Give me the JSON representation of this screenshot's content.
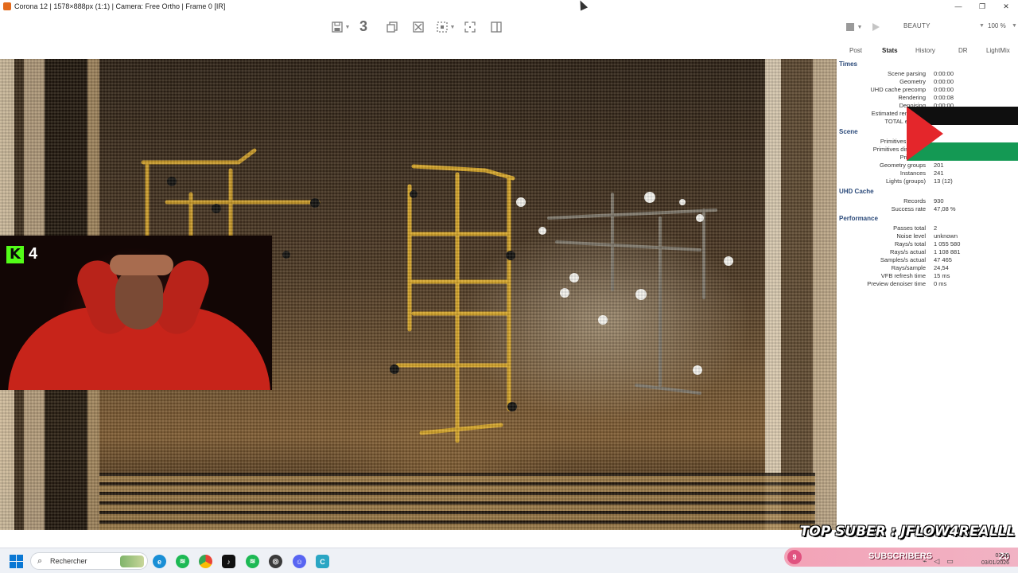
{
  "window": {
    "title": "Corona 12 | 1578×888px (1:1) | Camera: Free Ortho | Frame 0 [IR]",
    "controls": {
      "minimize": "—",
      "maximize": "❐",
      "close": "✕"
    }
  },
  "toolbar": {
    "pass_number": "3",
    "icons": [
      "save-icon",
      "copy-icon",
      "clear-icon",
      "region-icon",
      "fit-icon",
      "split-icon"
    ],
    "render_icons": [
      "stop-icon",
      "play-icon"
    ],
    "channel": "BEAUTY",
    "zoom": "100 %"
  },
  "panel": {
    "tabs": [
      {
        "label": "Post"
      },
      {
        "label": "Stats"
      },
      {
        "label": "History"
      },
      {
        "label": "DR"
      },
      {
        "label": "LightMix"
      }
    ],
    "active_tab": "Stats",
    "sections": [
      {
        "title": "Times",
        "rows": [
          {
            "label": "Scene parsing",
            "value": "0:00:00"
          },
          {
            "label": "Geometry",
            "value": "0:00:00"
          },
          {
            "label": "UHD cache precomp",
            "value": "0:00:00"
          },
          {
            "label": "Rendering",
            "value": "0:00:08"
          },
          {
            "label": "Denoising",
            "value": "0:00:00"
          },
          {
            "label": "Estimated remaining",
            "value": ""
          },
          {
            "label": "TOTAL elapsed",
            "value": ""
          }
        ]
      },
      {
        "title": "Scene",
        "rows": [
          {
            "label": "Primitives unique",
            "value": ""
          },
          {
            "label": "Primitives displaced",
            "value": ""
          },
          {
            "label": "Primitives",
            "value": ""
          },
          {
            "label": "Geometry groups",
            "value": "201"
          },
          {
            "label": "Instances",
            "value": "241"
          },
          {
            "label": "Lights (groups)",
            "value": "13 (12)"
          }
        ]
      },
      {
        "title": "UHD Cache",
        "rows": [
          {
            "label": "Records",
            "value": "930"
          },
          {
            "label": "Success rate",
            "value": "47,08 %"
          }
        ]
      },
      {
        "title": "Performance",
        "rows": [
          {
            "label": "Passes total",
            "value": "2"
          },
          {
            "label": "Noise level",
            "value": "unknown"
          },
          {
            "label": "Rays/s total",
            "value": "1 055 580"
          },
          {
            "label": "Rays/s actual",
            "value": "1 108 881"
          },
          {
            "label": "Samples/s actual",
            "value": "47 465"
          },
          {
            "label": "Rays/sample",
            "value": "24,54"
          },
          {
            "label": "VFB refresh time",
            "value": "15 ms"
          },
          {
            "label": "Preview denoiser time",
            "value": "0 ms"
          }
        ]
      }
    ]
  },
  "overlay": {
    "kick_logo": "K",
    "kick_viewers": "4",
    "top_suber": "TOP SUBER : JFLOW4REALLL",
    "subs_count": "9",
    "subs_label": "SUBSCRIBERS",
    "subs_number": "20",
    "flag_colors": {
      "black": "#0f0f0f",
      "white": "#ffffff",
      "green": "#149954",
      "red": "#e4262b"
    }
  },
  "taskbar": {
    "search_placeholder": "Rechercher",
    "apps": [
      "edge-icon",
      "spotify-icon",
      "chrome-icon",
      "tiktok-icon",
      "spotify-icon-2",
      "obs-icon",
      "discord-icon",
      "corona-icon"
    ],
    "clock_time": "03:20",
    "clock_date": "03/01/2026"
  }
}
